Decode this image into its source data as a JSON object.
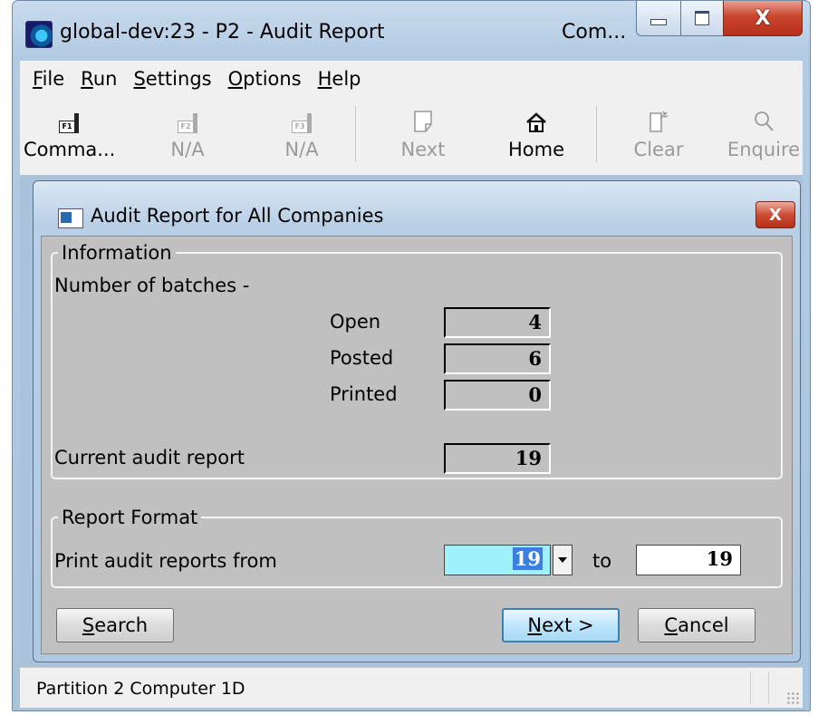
{
  "window": {
    "title": "global-dev:23 - P2 - Audit Report",
    "title_right": "Com...",
    "close_glyph": "X"
  },
  "menu": {
    "file": {
      "key": "F",
      "rest": "ile"
    },
    "run": {
      "key": "R",
      "rest": "un"
    },
    "settings": {
      "key": "S",
      "rest": "ettings"
    },
    "options": {
      "key": "O",
      "rest": "ptions"
    },
    "help": {
      "key": "H",
      "rest": "elp"
    }
  },
  "toolbar": {
    "commands": {
      "label": "Comma...",
      "key": "F1"
    },
    "f2": {
      "label": "N/A",
      "key": "F2"
    },
    "f3": {
      "label": "N/A",
      "key": "F3"
    },
    "next": {
      "label": "Next"
    },
    "home": {
      "label": "Home"
    },
    "clear": {
      "label": "Clear"
    },
    "enquire": {
      "label": "Enquire"
    }
  },
  "dialog": {
    "title": "Audit Report for All Companies",
    "close_glyph": "X",
    "information": {
      "legend": "Information",
      "batches_label": "Number of batches -",
      "open_label": "Open",
      "open_value": "4",
      "posted_label": "Posted",
      "posted_value": "6",
      "printed_label": "Printed",
      "printed_value": "0",
      "current_label": "Current audit report",
      "current_value": "19"
    },
    "report_format": {
      "legend": "Report Format",
      "from_label": "Print audit reports from",
      "from_value": "19",
      "to_label": "to",
      "to_value": "19"
    },
    "buttons": {
      "search": {
        "key": "S",
        "rest": "earch"
      },
      "next": {
        "key": "N",
        "rest": "ext >"
      },
      "cancel": {
        "key": "C",
        "rest": "ancel"
      }
    }
  },
  "status": {
    "text": "Partition 2 Computer 1D"
  },
  "colors": {
    "selection": "#3b7fe0",
    "input_highlight": "#9ff1fb",
    "close_red": "#c9452d",
    "default_button": "#3c7fb1"
  }
}
